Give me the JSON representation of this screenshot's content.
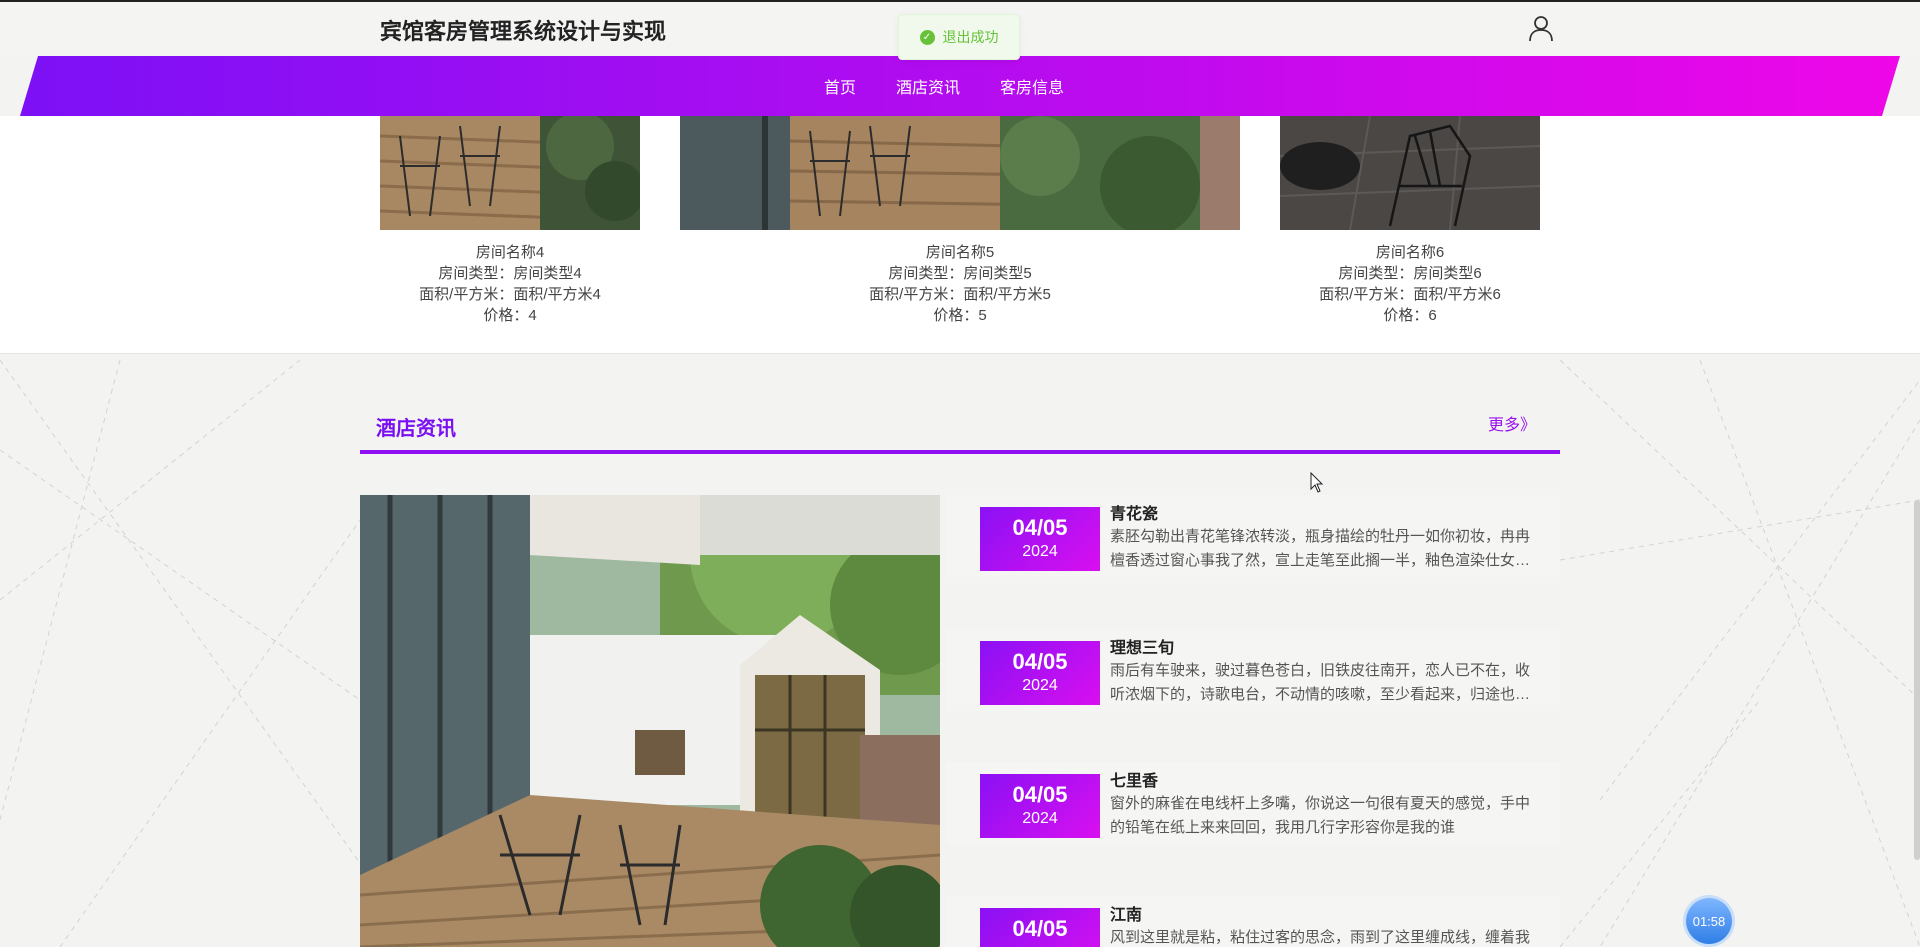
{
  "header": {
    "site_title": "宾馆客房管理系统设计与实现",
    "user_icon": "user-icon"
  },
  "toast": {
    "icon": "check-circle-icon",
    "text": "退出成功",
    "color": "#67c23a"
  },
  "nav": {
    "items": [
      {
        "label": "首页"
      },
      {
        "label": "酒店资讯"
      },
      {
        "label": "客房信息"
      }
    ],
    "gradient": [
      "#7d10f6",
      "#ee07e8"
    ]
  },
  "rooms": [
    {
      "name": "房间名称4",
      "type_line": "房间类型：房间类型4",
      "area_line": "面积/平方米：面积/平方米4",
      "price_line": "价格：4"
    },
    {
      "name": "房间名称5",
      "type_line": "房间类型：房间类型5",
      "area_line": "面积/平方米：面积/平方米5",
      "price_line": "价格：5"
    },
    {
      "name": "房间名称6",
      "type_line": "房间类型：房间类型6",
      "area_line": "面积/平方米：面积/平方米6",
      "price_line": "价格：6"
    }
  ],
  "news": {
    "section_title": "酒店资讯",
    "more_label": "更多》",
    "items": [
      {
        "md": "04/05",
        "year": "2024",
        "title": "青花瓷",
        "excerpt": "素胚勾勒出青花笔锋浓转淡，瓶身描绘的牡丹一如你初妆，冉冉檀香透过窗心事我了然，宣上走笔至此搁一半，釉色渲染仕女图韵味被私藏"
      },
      {
        "md": "04/05",
        "year": "2024",
        "title": "理想三旬",
        "excerpt": "雨后有车驶来，驶过暮色苍白，旧铁皮往南开，恋人已不在，收听浓烟下的，诗歌电台，不动情的咳嗽，至少看起来，归途也还可爱"
      },
      {
        "md": "04/05",
        "year": "2024",
        "title": "七里香",
        "excerpt": "窗外的麻雀在电线杆上多嘴，你说这一句很有夏天的感觉，手中的铅笔在纸上来来回回，我用几行字形容你是我的谁"
      },
      {
        "md": "04/05",
        "year": "",
        "title": "江南",
        "excerpt": "风到这里就是粘，粘住过客的思念，雨到了这里缠成线，缠着我们留恋人世间"
      }
    ]
  },
  "timer": {
    "text": "01:58"
  }
}
